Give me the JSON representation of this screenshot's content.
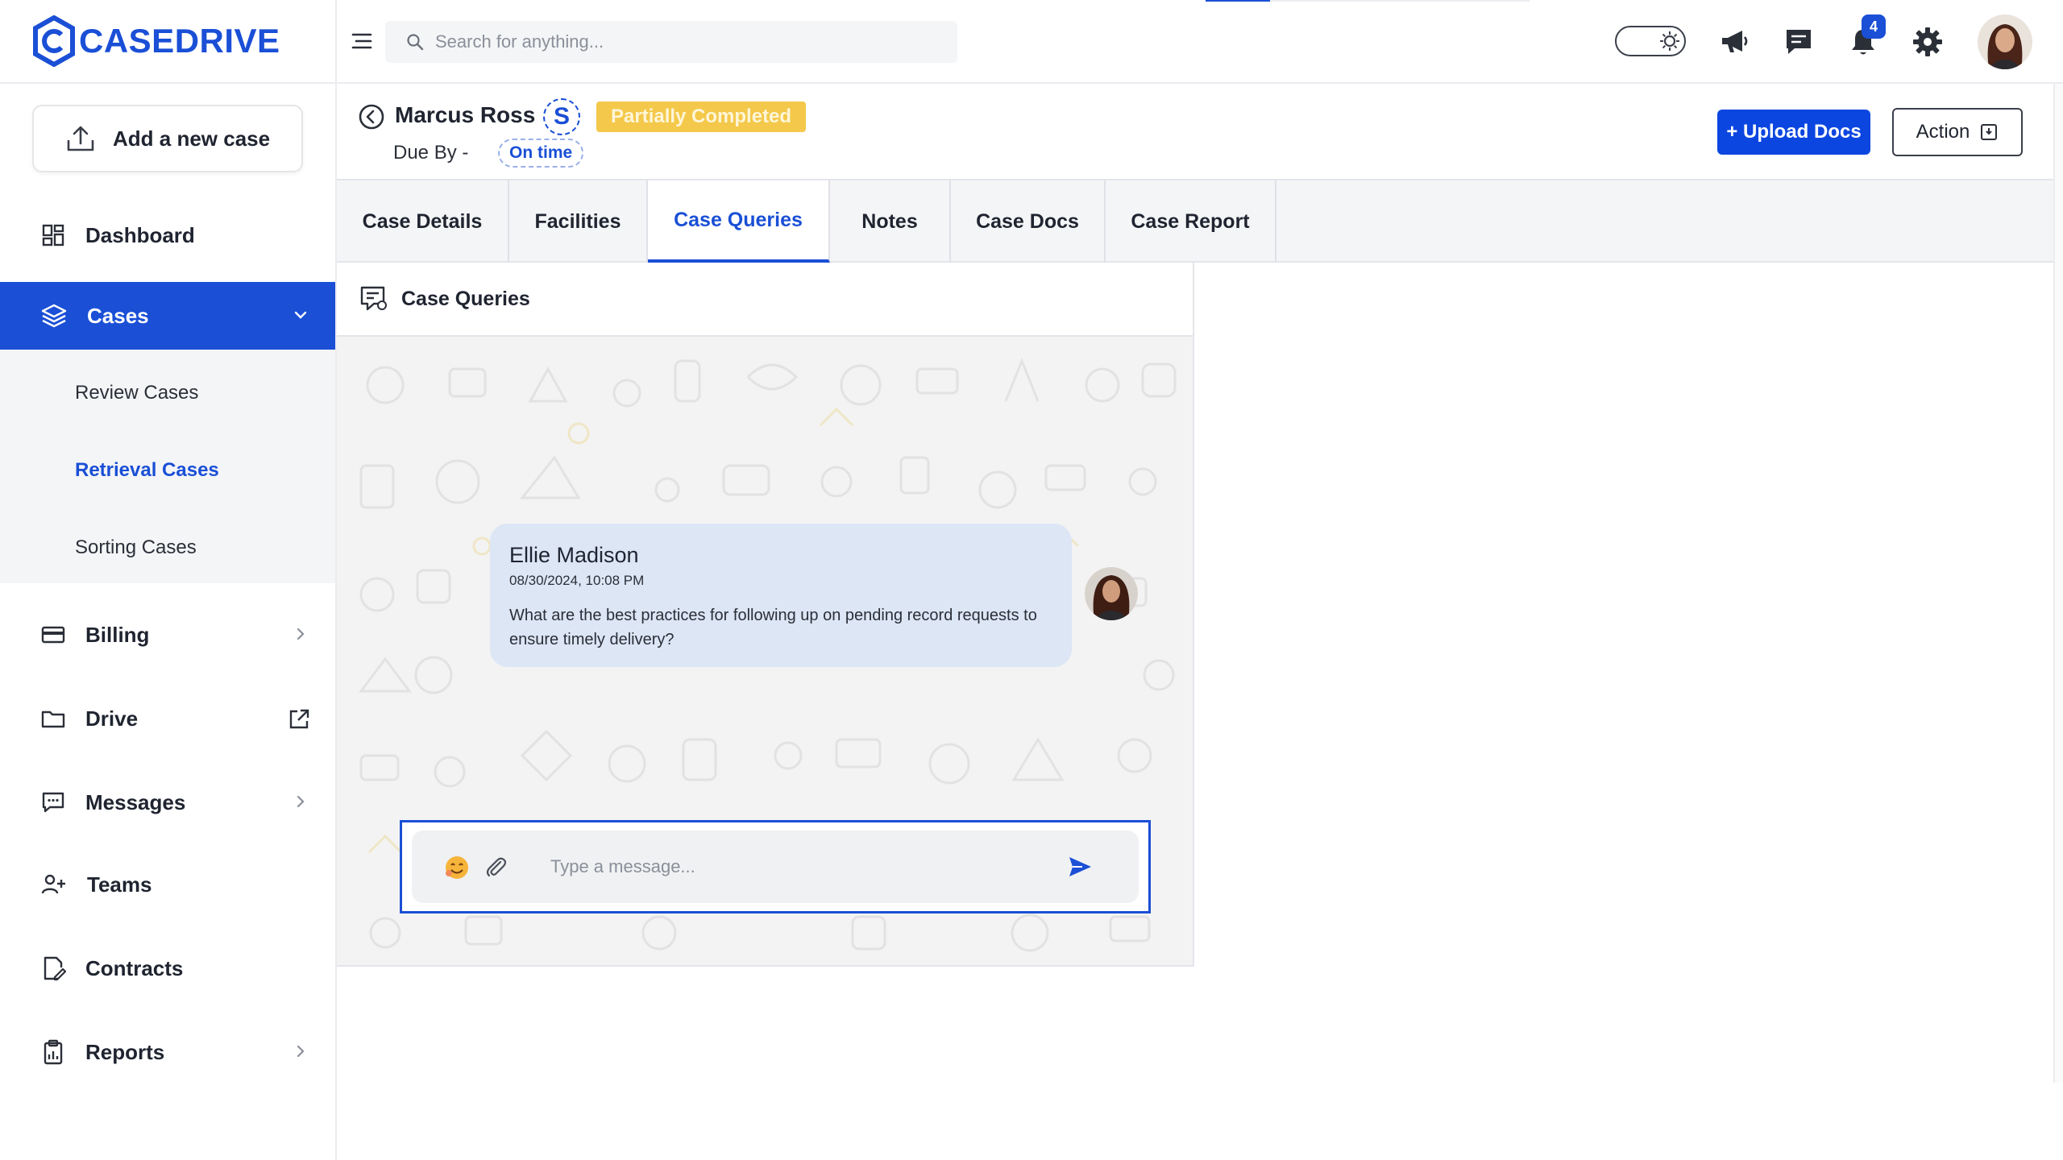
{
  "brand": {
    "name": "CASEDRIVE",
    "accent": "#1a4fd6"
  },
  "sidebar": {
    "add_case_label": "Add a new case",
    "items": [
      {
        "label": "Dashboard",
        "icon": "dashboard-icon"
      },
      {
        "label": "Cases",
        "icon": "layers-icon",
        "active": true,
        "expanded": true
      },
      {
        "label": "Billing",
        "icon": "card-icon"
      },
      {
        "label": "Drive",
        "icon": "folder-icon"
      },
      {
        "label": "Messages",
        "icon": "message-icon"
      },
      {
        "label": "Teams",
        "icon": "team-icon"
      },
      {
        "label": "Contracts",
        "icon": "contract-icon"
      },
      {
        "label": "Reports",
        "icon": "report-icon"
      }
    ],
    "subitems": [
      {
        "label": "Review Cases"
      },
      {
        "label": "Retrieval Cases",
        "active": true
      },
      {
        "label": "Sorting Cases"
      }
    ]
  },
  "topbar": {
    "search_placeholder": "Search for anything...",
    "notification_count": "4"
  },
  "case": {
    "name": "Marcus Ross",
    "initial": "S",
    "status": "Partially Completed",
    "due_label": "Due By -",
    "due_status": "On time",
    "upload_label": "+ Upload Docs",
    "action_label": "Action"
  },
  "tabs": [
    {
      "label": "Case Details"
    },
    {
      "label": "Facilities"
    },
    {
      "label": "Case Queries",
      "active": true
    },
    {
      "label": "Notes"
    },
    {
      "label": "Case Docs"
    },
    {
      "label": "Case Report"
    }
  ],
  "queries": {
    "title": "Case Queries",
    "message": {
      "author": "Ellie Madison",
      "timestamp": "08/30/2024, 10:08 PM",
      "text": "What are the best practices for following up on pending record requests to ensure timely delivery?"
    },
    "composer_placeholder": "Type a message..."
  }
}
